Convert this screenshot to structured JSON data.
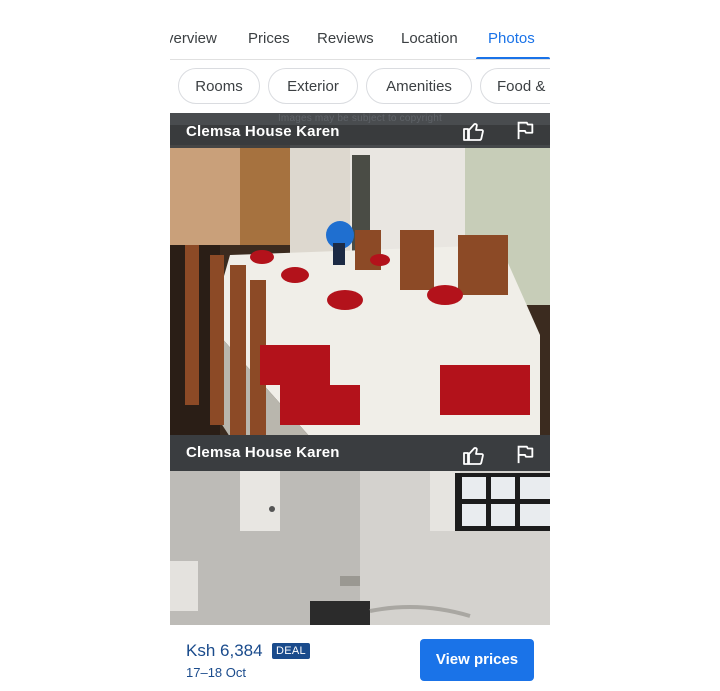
{
  "tabs": [
    {
      "label": "verview"
    },
    {
      "label": "Prices"
    },
    {
      "label": "Reviews"
    },
    {
      "label": "Location"
    },
    {
      "label": "Photos"
    }
  ],
  "active_tab": "Photos",
  "chips": [
    {
      "label": "Rooms"
    },
    {
      "label": "Exterior"
    },
    {
      "label": "Amenities"
    },
    {
      "label": "Food & c"
    }
  ],
  "copyright_note": "Images may be subject to copyright",
  "photos": [
    {
      "title": "Clemsa House Karen",
      "icons": [
        "thumbs-up-icon",
        "flag-icon"
      ]
    },
    {
      "title": "Clemsa House Karen",
      "icons": [
        "thumbs-up-icon",
        "flag-icon"
      ]
    }
  ],
  "booking": {
    "price": "Ksh 6,384",
    "badge": "DEAL",
    "dates": "17–18 Oct",
    "button": "View prices"
  },
  "colors": {
    "accent": "#1a73e8",
    "price_text": "#1a4b8c",
    "bar_bg": "#3a3d40"
  }
}
